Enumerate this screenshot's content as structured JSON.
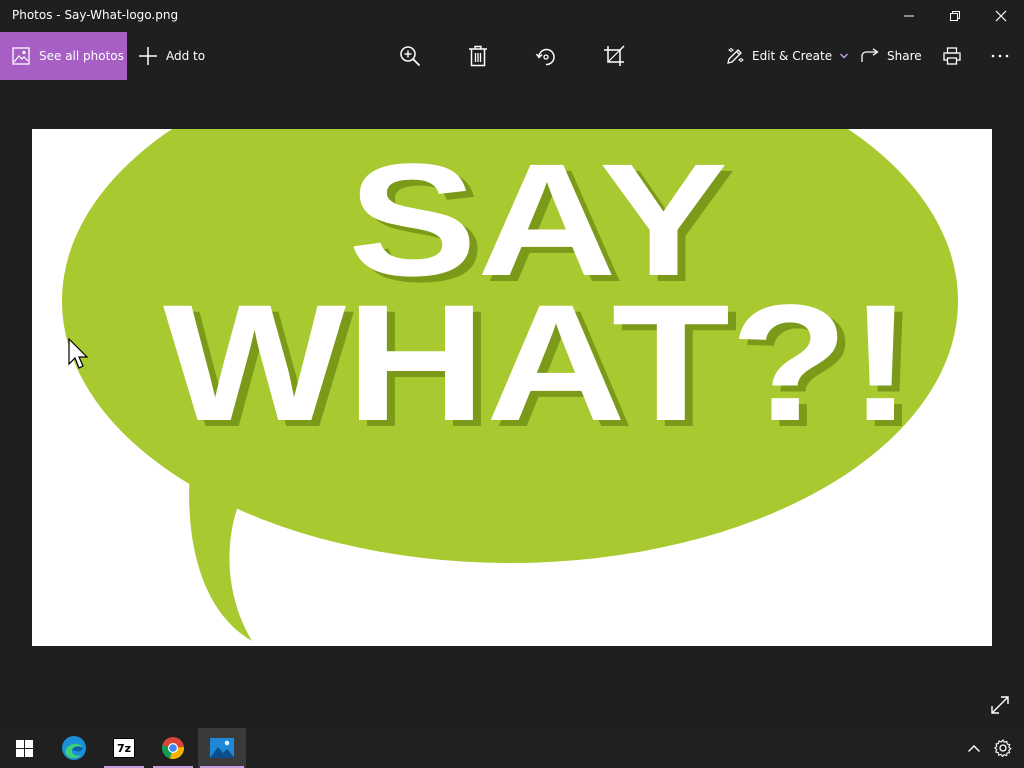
{
  "window": {
    "title": "Photos - Say-What-logo.png"
  },
  "toolbar": {
    "see_all_label": "See all photos",
    "add_to_label": "Add to",
    "edit_create_label": "Edit & Create",
    "share_label": "Share"
  },
  "image": {
    "line1": "SAY",
    "line2": "WHAT?!",
    "bubble_color": "#a8c92f",
    "shadow_color": "#7b9a1a"
  },
  "colors": {
    "accent": "#a75ec5",
    "background": "#1f1f1f",
    "taskbar": "#202020"
  },
  "icons": {
    "titlebar": [
      "minimize-icon",
      "restore-icon",
      "close-icon"
    ],
    "toolbar": [
      "photos-icon",
      "plus-icon",
      "zoom-in-icon",
      "delete-icon",
      "rotate-icon",
      "crop-icon",
      "edit-create-icon",
      "chevron-down-icon",
      "share-icon",
      "print-icon",
      "more-icon"
    ],
    "taskbar": [
      "windows-start-icon",
      "edge-icon",
      "7zip-icon",
      "chrome-icon",
      "photos-app-icon",
      "chevron-up-icon",
      "settings-icon"
    ]
  },
  "taskbar": {
    "sevenzip_label": "7z"
  }
}
